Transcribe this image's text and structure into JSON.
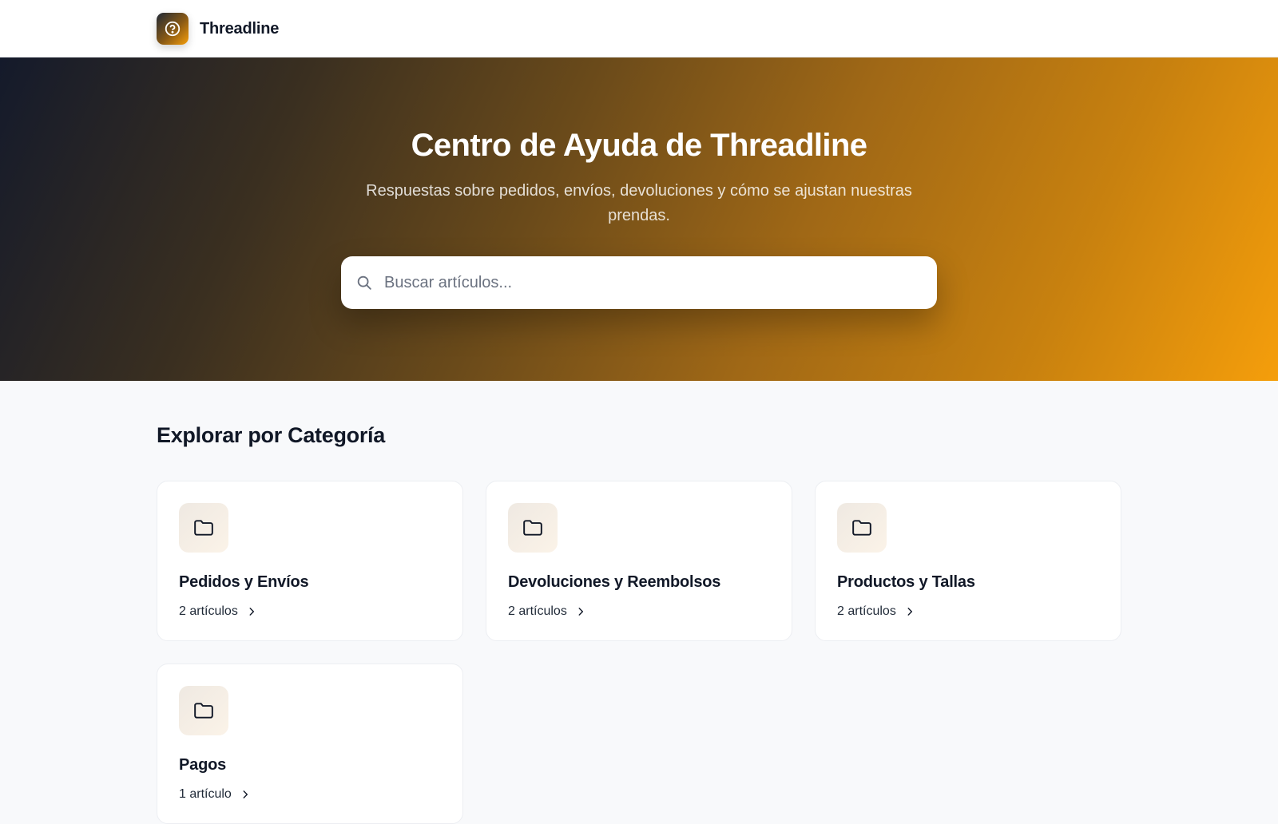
{
  "brand": {
    "name": "Threadline",
    "logo_icon": "help-circle-icon",
    "colors": {
      "dark": "#1f2937",
      "accent": "#f59e0b"
    }
  },
  "hero": {
    "title": "Centro de Ayuda de Threadline",
    "subtitle": "Respuestas sobre pedidos, envíos, devoluciones y cómo se ajustan nuestras prendas.",
    "search": {
      "placeholder": "Buscar artículos...",
      "value": "",
      "icon": "search-icon"
    },
    "gradient": [
      "#141a2b",
      "#f59e0b"
    ]
  },
  "categories_section": {
    "title": "Explorar por Categoría",
    "items": [
      {
        "title": "Pedidos y Envíos",
        "count": "2 artículos",
        "icon": "folder-icon"
      },
      {
        "title": "Devoluciones y Reembolsos",
        "count": "2 artículos",
        "icon": "folder-icon"
      },
      {
        "title": "Productos y Tallas",
        "count": "2 artículos",
        "icon": "folder-icon"
      },
      {
        "title": "Pagos",
        "count": "1 artículo",
        "icon": "folder-icon"
      }
    ]
  }
}
